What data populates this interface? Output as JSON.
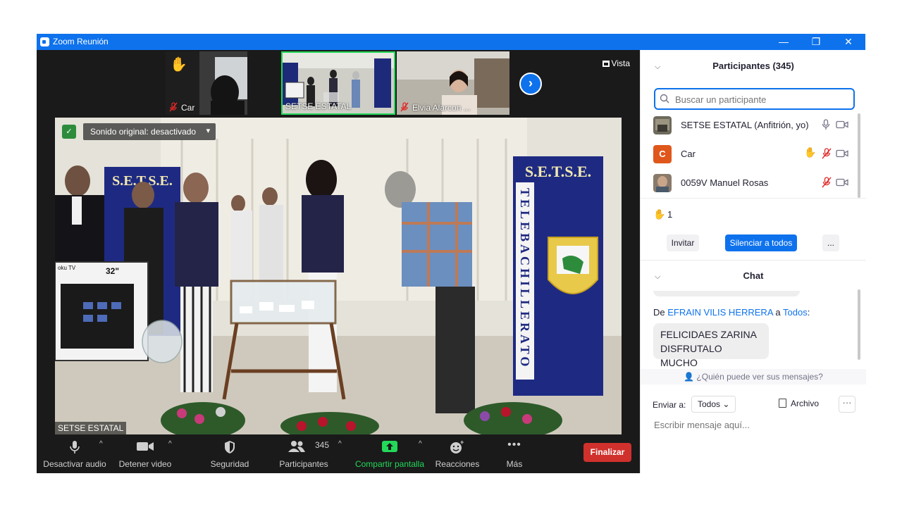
{
  "window": {
    "title": "Zoom Reunión",
    "controls": [
      "—",
      "❐",
      "✕"
    ]
  },
  "thumbnails": [
    {
      "name": "Car",
      "raised_hand": true,
      "muted": true
    },
    {
      "name": "SETSE ESTATAL",
      "active": true
    },
    {
      "name": "Elvia Alarcon ...",
      "muted": true
    }
  ],
  "view_button": "Vista",
  "main_video": {
    "audio_status": "Sonido original: desactivado",
    "speaker_name": "SETSE ESTATAL",
    "banner_left": "S.E.T.S.E.",
    "banner_right": "S.E.T.S.E.",
    "banner_vertical": "TELEBACHILLERATO",
    "tv_size": "32\"",
    "tv_brand": "oku TV"
  },
  "toolbar": {
    "mute": "Desactivar audio",
    "video": "Detener video",
    "security": "Seguridad",
    "participants": "Participantes",
    "participant_count": "345",
    "share": "Compartir pantalla",
    "reactions": "Reacciones",
    "more": "Más",
    "end": "Finalizar"
  },
  "participants_panel": {
    "title": "Participantes (345)",
    "search_placeholder": "Buscar un participante",
    "list": [
      {
        "name": "SETSE ESTATAL (Anfitrión, yo)"
      },
      {
        "name": "Car",
        "initial": "C",
        "avatar_color": "#e0571b"
      },
      {
        "name": "0059V Manuel Rosas"
      }
    ],
    "raised_hands": "1",
    "invite": "Invitar",
    "mute_all": "Silenciar a todos",
    "more": "..."
  },
  "chat": {
    "title": "Chat",
    "from_prefix": "De ",
    "sender": "EFRAIN VILIS HERRERA",
    "to_word": " a ",
    "recipient": "Todos",
    "colon": ":",
    "message_line1": "FELICIDAES ZARINA",
    "message_line2": "DISFRUTALO MUCHO",
    "who_can_see": "¿Quién puede ver sus mensajes?",
    "send_to_label": "Enviar a:",
    "send_to_value": "Todos",
    "file": "Archivo",
    "input_placeholder": "Escribir mensaje aquí..."
  },
  "colors": {
    "accent": "#0e72ed",
    "end": "#d0312d",
    "share": "#23d959"
  }
}
